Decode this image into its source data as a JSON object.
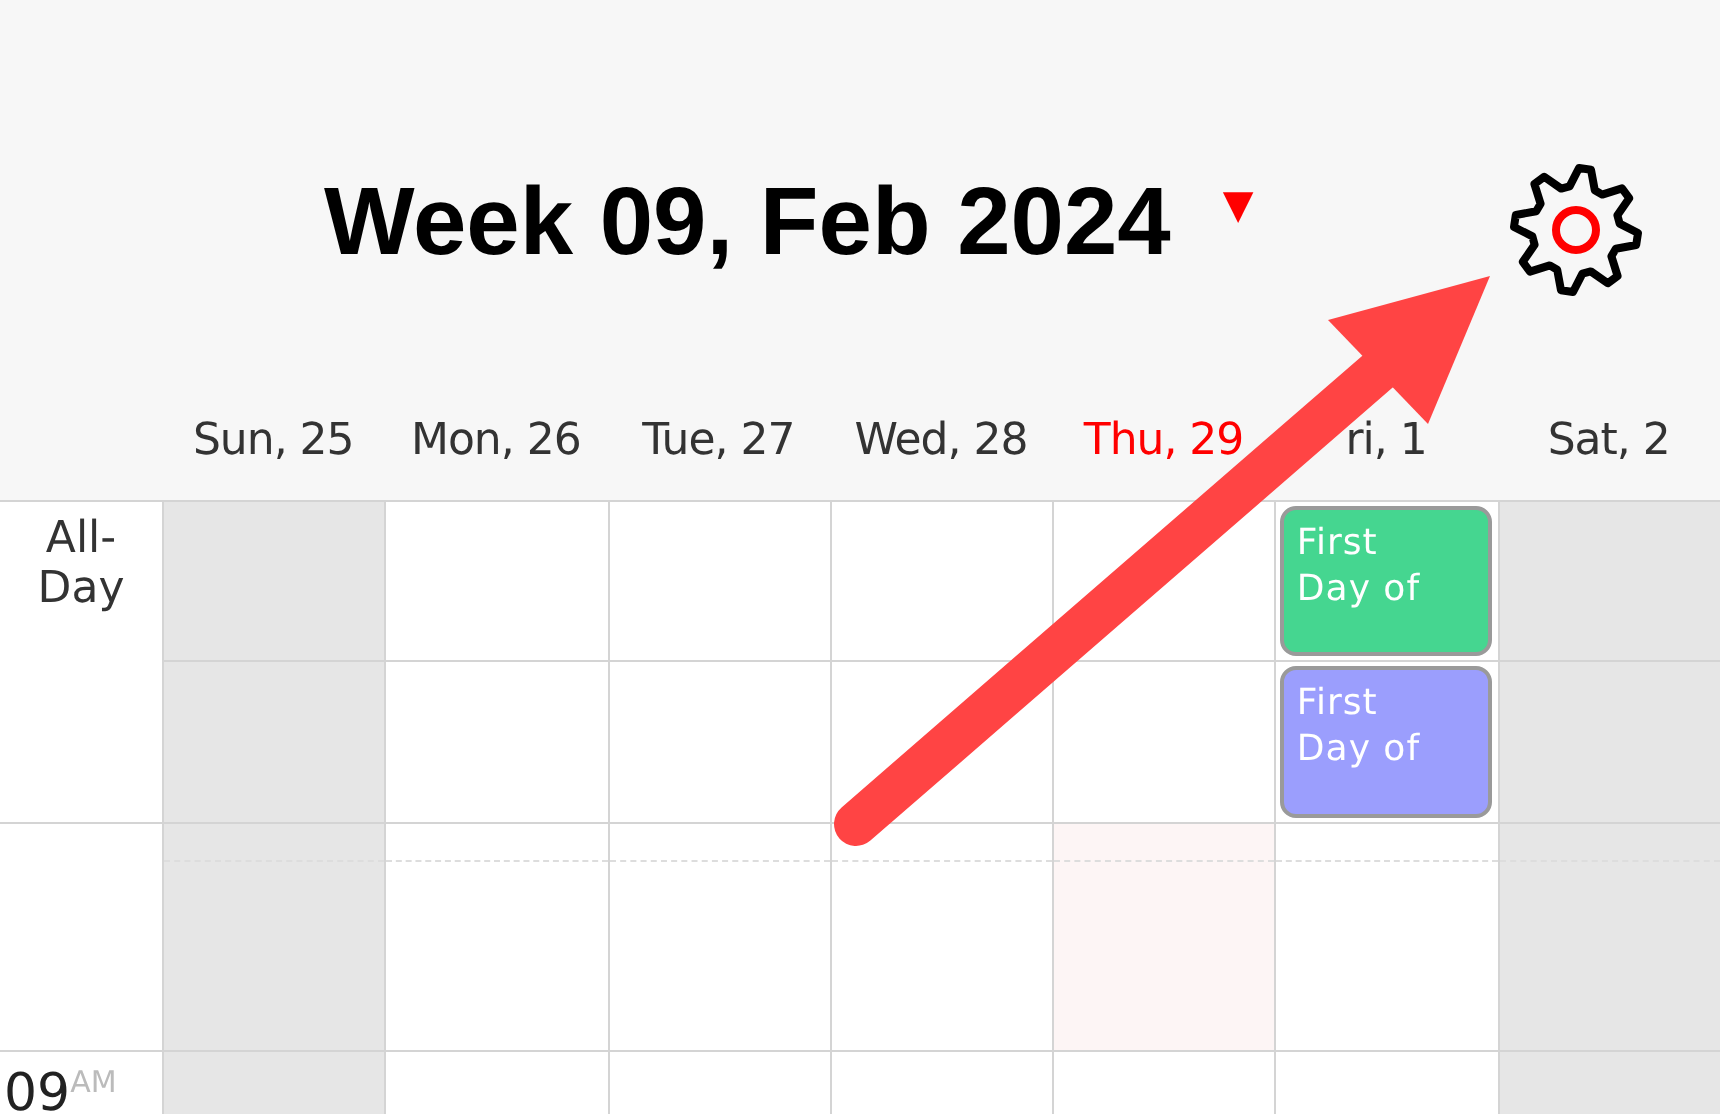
{
  "header": {
    "title": "Week 09, Feb 2024",
    "caret": "▼"
  },
  "days": [
    {
      "label": "Sun, 25",
      "today": false,
      "weekend": true
    },
    {
      "label": "Mon, 26",
      "today": false,
      "weekend": false
    },
    {
      "label": "Tue, 27",
      "today": false,
      "weekend": false
    },
    {
      "label": "Wed, 28",
      "today": false,
      "weekend": false
    },
    {
      "label": "Thu, 29",
      "today": true,
      "weekend": false
    },
    {
      "label": "ri, 1",
      "today": false,
      "weekend": false,
      "all_day": [
        {
          "title": "First Day of",
          "color": "#45d690"
        },
        {
          "title": "First Day of",
          "color": "#9b9efd"
        }
      ]
    },
    {
      "label": "Sat, 2",
      "today": false,
      "weekend": true
    }
  ],
  "all_day_label": "All-Day",
  "time_slots": [
    {
      "hour": "09",
      "meridiem": "AM"
    }
  ]
}
